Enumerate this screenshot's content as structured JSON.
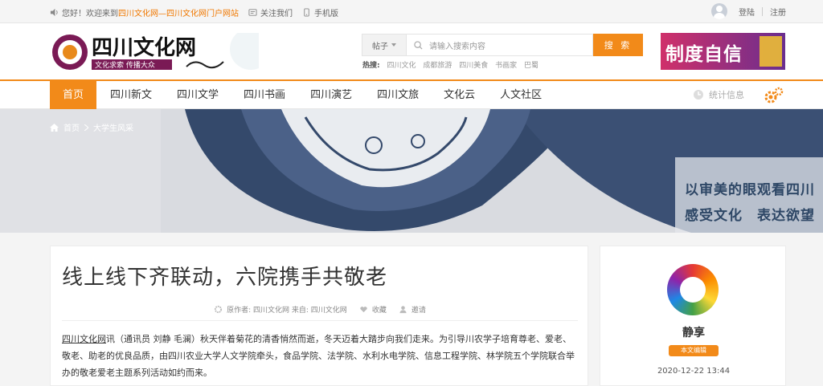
{
  "topbar": {
    "welcome": "您好！欢迎来到",
    "site_name": "四川文化网—四川文化网门户网站",
    "follow": "关注我们",
    "mobile": "手机版",
    "login": "登陆",
    "register": "注册"
  },
  "header": {
    "logo_name": "四川文化网",
    "logo_slogan": "文化求索 传播大众",
    "search_category": "帖子",
    "search_placeholder": "请输入搜索内容",
    "search_button": "搜 索",
    "hot_label": "热搜:",
    "hot_terms": [
      "四川文化",
      "成都旅游",
      "四川美食",
      "书画家",
      "巴蜀"
    ],
    "ad_text": "制度自信"
  },
  "nav": {
    "items": [
      "首页",
      "四川新文",
      "四川文学",
      "四川书画",
      "四川演艺",
      "四川文旅",
      "文化云",
      "人文社区"
    ],
    "stat": "统计信息"
  },
  "hero": {
    "crumb_home": "首页",
    "crumb_current": "大学生风采",
    "slogan_line1": "以审美的眼观看四川",
    "slogan_line2": "感受文化　表达欲望"
  },
  "article": {
    "title": "线上线下齐联动，六院携手共敬老",
    "meta_author": "原作者: 四川文化网 来自: 四川文化网",
    "meta_fav": "收藏",
    "meta_invite": "邀请",
    "body_link": "四川文化网",
    "body_text": "讯（通讯员 刘静 毛澜）秋天伴着菊花的清香悄然而逝，冬天迈着大踏步向我们走来。为引导川农学子培育尊老、爱老、敬老、助老的优良品质，由四川农业大学人文学院牵头，食品学院、法学院、水利水电学院、信息工程学院、林学院五个学院联合举办的敬老爱老主题系列活动如约而来。"
  },
  "sidebar": {
    "name": "静享",
    "badge": "本文编辑",
    "time": "2020-12-22 13:44"
  },
  "colors": {
    "accent": "#f28a19",
    "hero_blue": "#2e4766"
  }
}
